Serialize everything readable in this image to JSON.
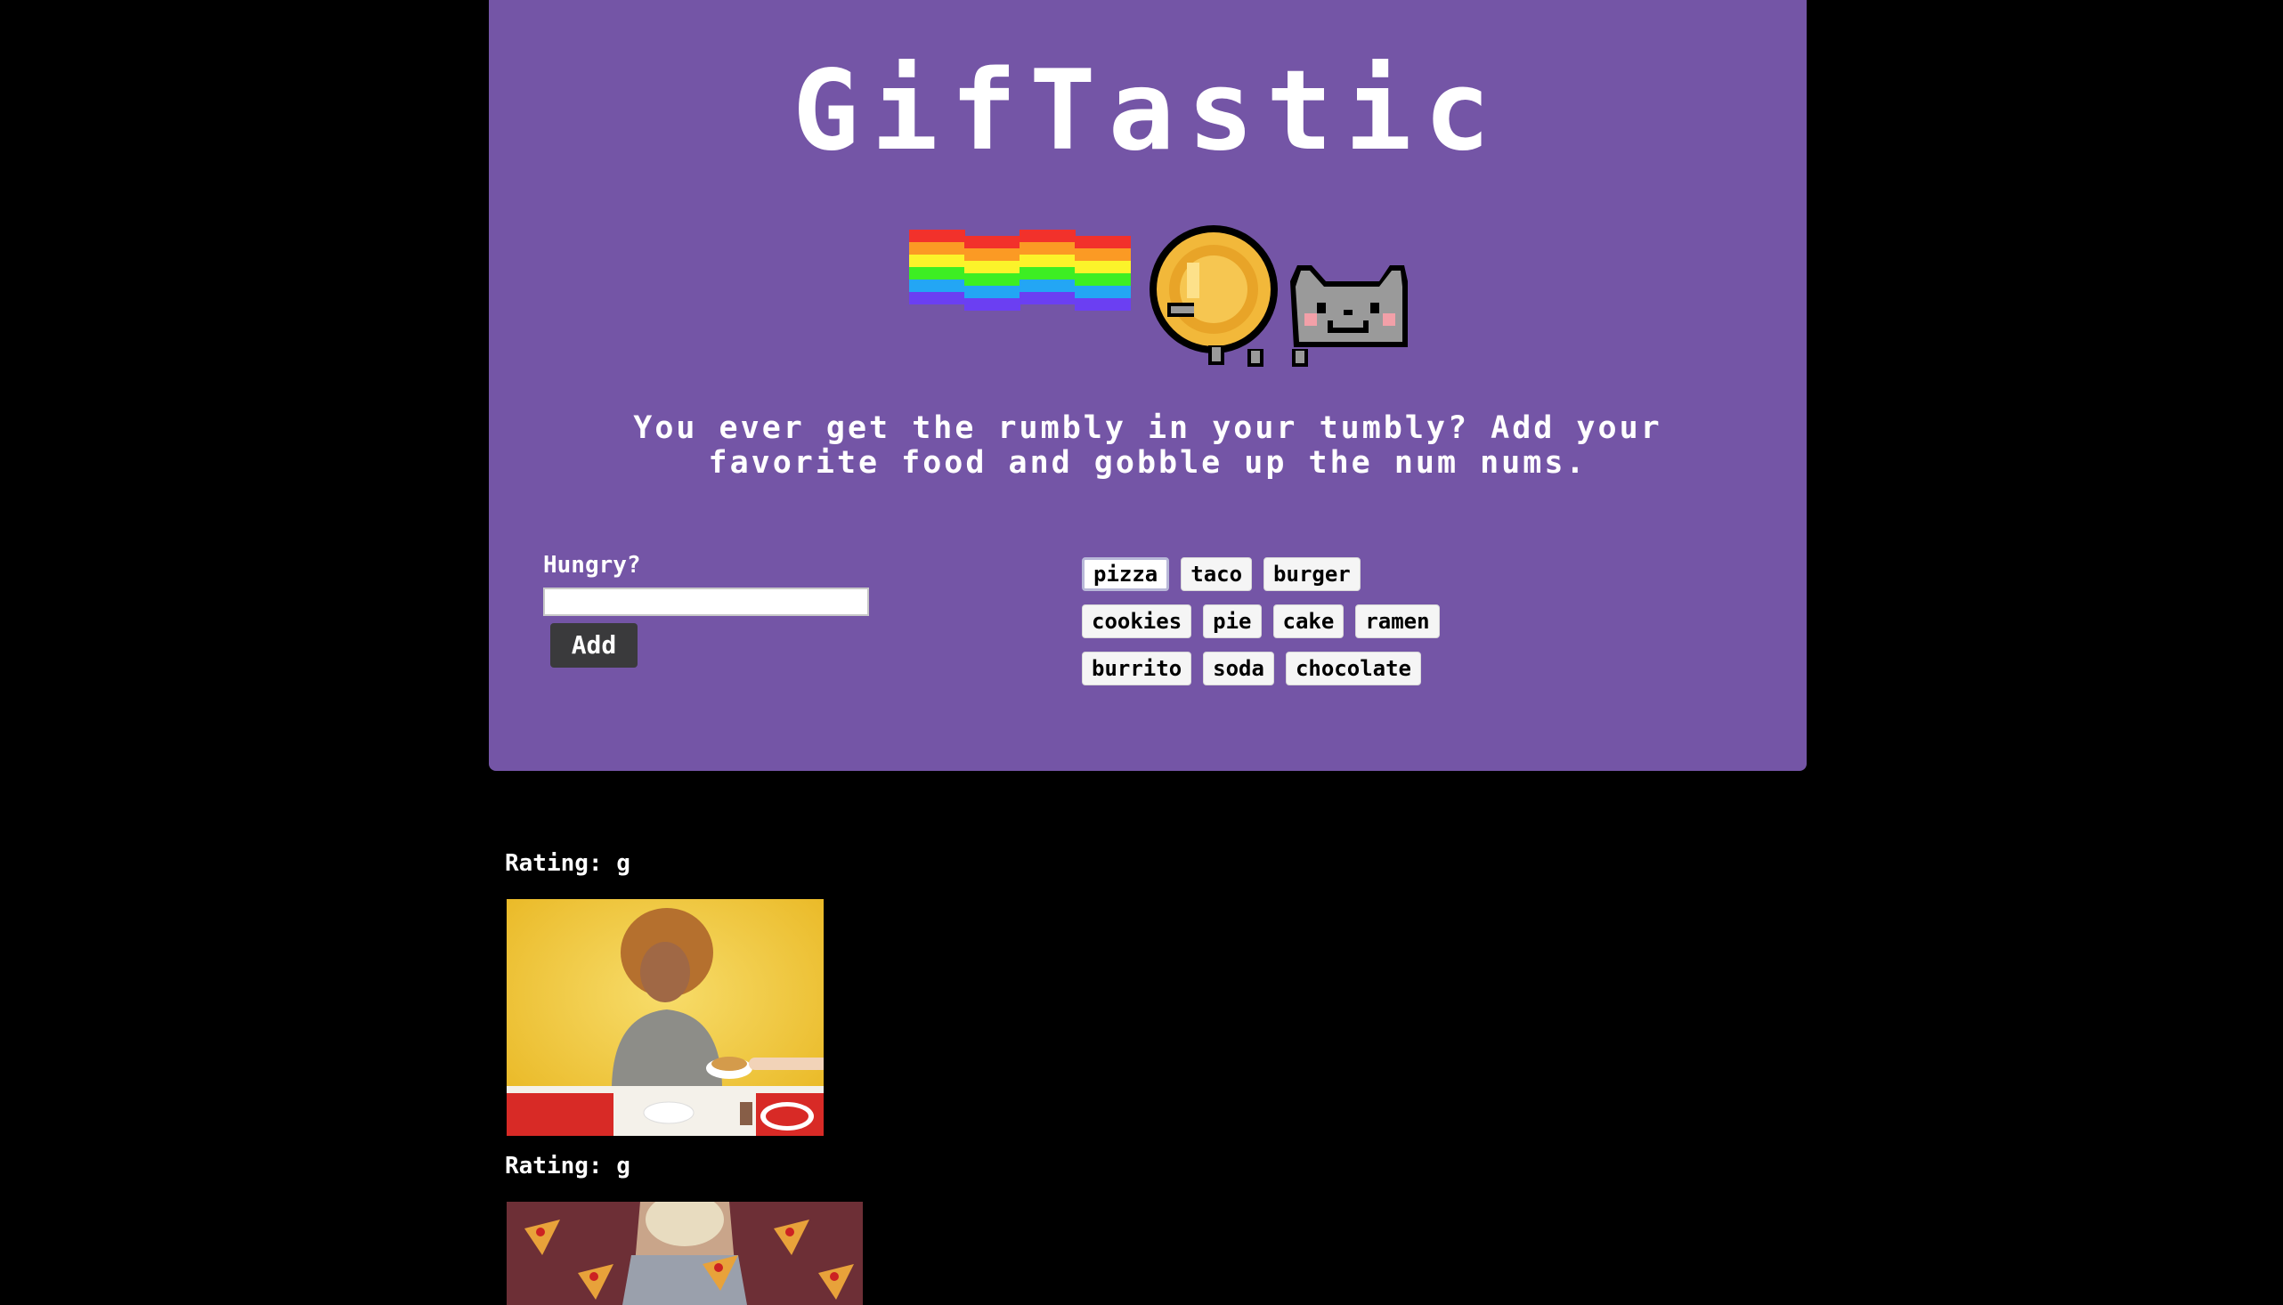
{
  "header": {
    "title": "GifTastic",
    "tagline": "You ever get the rumbly in your tumbly? Add your favorite food and gobble up the num nums.",
    "logo_icon": "nyan-cat-icon"
  },
  "search": {
    "label": "Hungry?",
    "value": "",
    "placeholder": "",
    "add_label": "Add"
  },
  "food_buttons": [
    [
      "pizza",
      "taco",
      "burger"
    ],
    [
      "cookies",
      "pie",
      "cake",
      "ramen"
    ],
    [
      "burrito",
      "soda",
      "chocolate"
    ]
  ],
  "active_food": "pizza",
  "results": [
    {
      "rating_label": "Rating: g",
      "image": "woman-eating-pizza-rolls-gif"
    },
    {
      "rating_label": "Rating: g",
      "image": "singer-with-pizza-slices-gif"
    }
  ],
  "colors": {
    "background": "#000000",
    "panel": "#7455a6",
    "title": "#ffffff",
    "button_dark": "#3a3a3c",
    "food_button": "#f5f5f5"
  }
}
